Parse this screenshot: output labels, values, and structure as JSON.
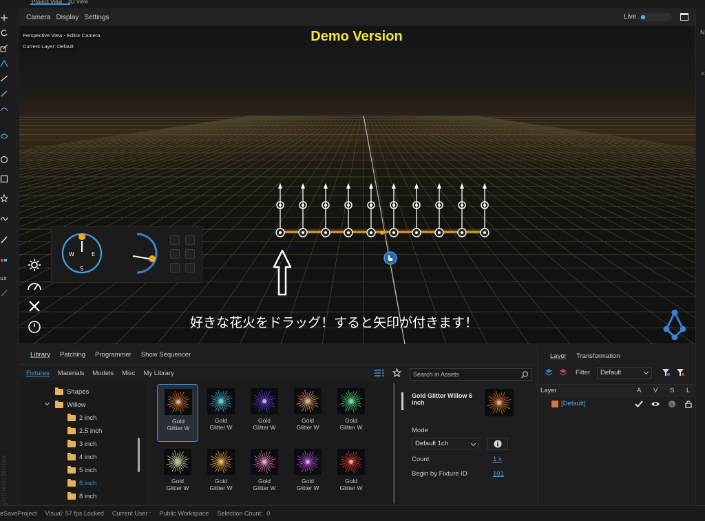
{
  "top_strip": {
    "tabs": [
      "Project View",
      "3D View"
    ]
  },
  "view_menu": {
    "items": [
      "Camera",
      "Display",
      "Settings"
    ],
    "live_label": "Live"
  },
  "viewport": {
    "labels": [
      "Perspective View - Editor Camera",
      "Current Layer: Default"
    ],
    "demo_title": "Demo Version",
    "caption": "好きな花火をドラッグ！すると矢印が付きます！",
    "compass": {
      "w": "W",
      "e": "E",
      "s": "S"
    }
  },
  "library": {
    "main_tabs": [
      "Library",
      "Patching",
      "Programmer",
      "Show Sequencer"
    ],
    "sub_tabs": [
      "Fixtures",
      "Materials",
      "Models",
      "Misc",
      "My Library"
    ],
    "search_placeholder": "Search in Assets",
    "tree": [
      {
        "label": "Shapes",
        "indent": 1,
        "selected": false
      },
      {
        "label": "Willow",
        "indent": 1,
        "selected": false,
        "expanded": true
      },
      {
        "label": "2 inch",
        "indent": 2,
        "selected": false
      },
      {
        "label": "2.5 inch",
        "indent": 2,
        "selected": false
      },
      {
        "label": "3 inch",
        "indent": 2,
        "selected": false
      },
      {
        "label": "4 inch",
        "indent": 2,
        "selected": false
      },
      {
        "label": "5 inch",
        "indent": 2,
        "selected": false
      },
      {
        "label": "6 inch",
        "indent": 2,
        "selected": true
      },
      {
        "label": "8 inch",
        "indent": 2,
        "selected": false
      }
    ],
    "items": [
      {
        "caption_1": "Gold",
        "caption_2": "Glitter W",
        "color": "#e07a2a",
        "selected": true
      },
      {
        "caption_1": "Gold",
        "caption_2": "Glitter W",
        "color": "#38c9d4",
        "selected": false
      },
      {
        "caption_1": "Gold",
        "caption_2": "Glitter W",
        "color": "#6a3fe0",
        "selected": false
      },
      {
        "caption_1": "Gold",
        "caption_2": "Glitter W",
        "color": "#e8a060",
        "selected": false
      },
      {
        "caption_1": "Gold",
        "caption_2": "Glitter W",
        "color": "#3fe07a",
        "selected": false
      },
      {
        "caption_1": "Gold",
        "caption_2": "Glitter W",
        "color": "#d8e0a0",
        "selected": false
      },
      {
        "caption_1": "Gold",
        "caption_2": "Glitter W",
        "color": "#f0b030",
        "selected": false
      },
      {
        "caption_1": "Gold",
        "caption_2": "Glitter W",
        "color": "#e080b0",
        "selected": false
      },
      {
        "caption_1": "Gold",
        "caption_2": "Glitter W",
        "color": "#c050e0",
        "selected": false
      },
      {
        "caption_1": "Gold",
        "caption_2": "Glitter W",
        "color": "#e83a2a",
        "selected": false
      }
    ]
  },
  "details": {
    "title": "Gold Glitter Willow 6 inch",
    "mode_label": "Mode",
    "mode_value": "Default 1ch",
    "count_label": "Count",
    "count_value": "1 x",
    "begin_label": "Begin by Fixture ID",
    "begin_value": "101"
  },
  "layer_panel": {
    "tabs": [
      "Layer",
      "Transformation"
    ],
    "filter_label": "Filter",
    "filter_value": "Default",
    "columns": {
      "layer": "Layer",
      "a": "A",
      "v": "V",
      "s": "S",
      "l": "L"
    },
    "row_name": "[Default]"
  },
  "status": {
    "project": "eSaveProject",
    "visual": "Visual: 57 fps Locked",
    "user": "Current User :",
    "workspace": "Public Workspace",
    "selection": "Selection Count:",
    "selection_value": "0"
  },
  "right_strip": {
    "letter": "N"
  }
}
